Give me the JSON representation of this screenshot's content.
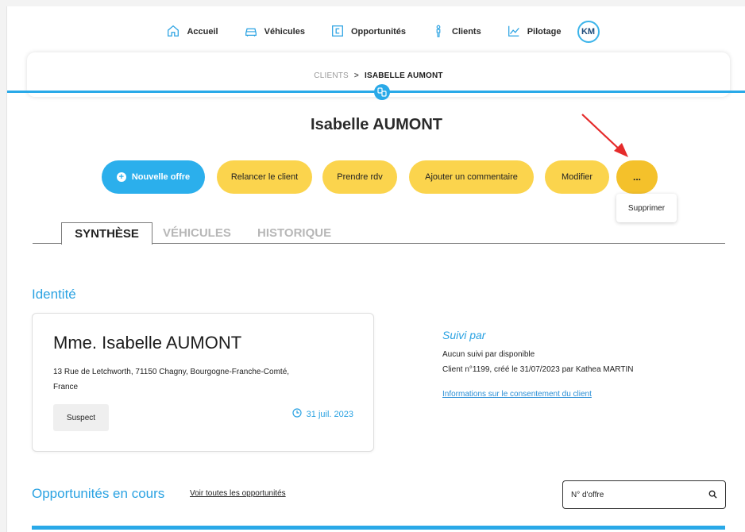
{
  "nav": {
    "items": [
      {
        "label": "Accueil",
        "icon": "home-icon"
      },
      {
        "label": "Véhicules",
        "icon": "car-icon"
      },
      {
        "label": "Opportunités",
        "icon": "opportunity-icon"
      },
      {
        "label": "Clients",
        "icon": "person-icon"
      },
      {
        "label": "Pilotage",
        "icon": "chart-icon"
      }
    ],
    "avatar": "KM"
  },
  "breadcrumb": {
    "parent": "CLIENTS",
    "separator": ">",
    "current": "ISABELLE AUMONT"
  },
  "page_title": "Isabelle AUMONT",
  "actions": {
    "new_offer": "Nouvelle offre",
    "relaunch": "Relancer le client",
    "appointment": "Prendre rdv",
    "comment": "Ajouter un commentaire",
    "edit": "Modifier",
    "more": "...",
    "more_menu": [
      "Supprimer"
    ]
  },
  "tabs": [
    "SYNTHÈSE",
    "VÉHICULES",
    "HISTORIQUE"
  ],
  "identity": {
    "section_title": "Identité",
    "name": "Mme. Isabelle AUMONT",
    "address_line1": "13 Rue de Letchworth, 71150 Chagny, Bourgogne-Franche-Comté,",
    "address_line2": "France",
    "status": "Suspect",
    "date": "31 juil. 2023"
  },
  "followup": {
    "title": "Suivi par",
    "line1": "Aucun suivi par disponible",
    "line2": "Client n°1199, créé le 31/07/2023 par Kathea MARTIN",
    "consent_link": "Informations sur le consentement du client"
  },
  "opportunities": {
    "section_title": "Opportunités en cours",
    "see_all": "Voir toutes les opportunités",
    "search_placeholder": "N° d'offre"
  },
  "colors": {
    "accent_blue": "#29a9e8",
    "button_yellow": "#fbd44d",
    "arrow_red": "#e52b2b"
  }
}
